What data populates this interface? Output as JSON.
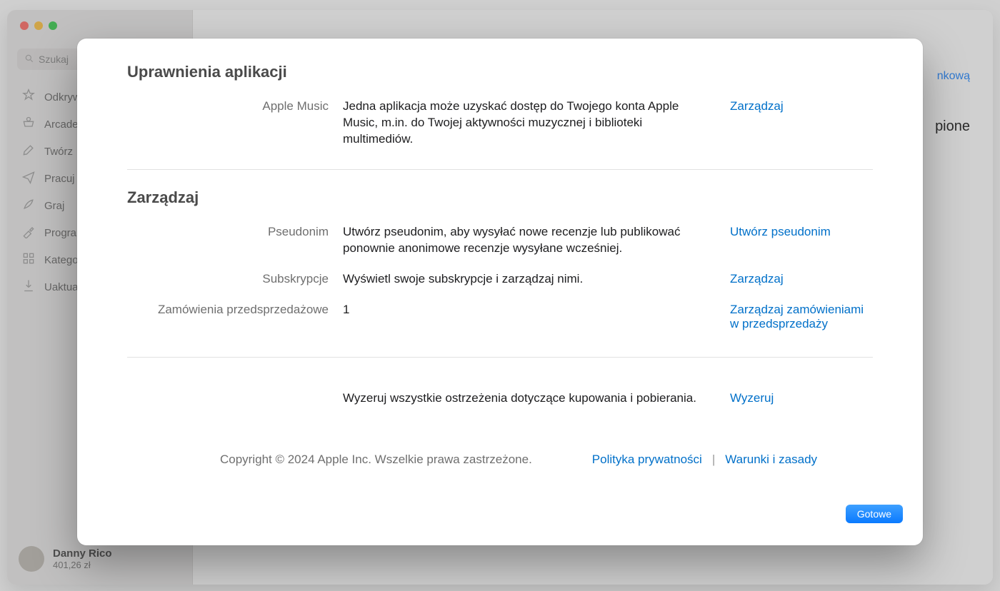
{
  "sidebar": {
    "search_placeholder": "Szukaj",
    "items": [
      {
        "label": "Odkrywaj"
      },
      {
        "label": "Arcade"
      },
      {
        "label": "Twórz"
      },
      {
        "label": "Pracuj"
      },
      {
        "label": "Graj"
      },
      {
        "label": "Programuj"
      },
      {
        "label": "Kategorie"
      },
      {
        "label": "Uaktualnienia"
      }
    ],
    "user": {
      "name": "Danny Rico",
      "balance": "401,26 zł"
    }
  },
  "background": {
    "header_link": "nkową",
    "right_heading": "pione"
  },
  "modal": {
    "sections": {
      "permissions": {
        "title": "Uprawnienia aplikacji",
        "apple_music": {
          "label": "Apple Music",
          "desc": "Jedna aplikacja może uzyskać dostęp do Twojego konta Apple Music, m.in. do Twojej aktywności muzycznej i biblioteki multimediów.",
          "action": "Zarządzaj"
        }
      },
      "manage": {
        "title": "Zarządzaj",
        "nickname": {
          "label": "Pseudonim",
          "desc": "Utwórz pseudonim, aby wysyłać nowe recenzje lub publikować ponownie anonimowe recenzje wysyłane wcześniej.",
          "action": "Utwórz pseudonim"
        },
        "subs": {
          "label": "Subskrypcje",
          "desc": "Wyświetl swoje subskrypcje i zarządzaj nimi.",
          "action": "Zarządzaj"
        },
        "preorders": {
          "label": "Zamówienia przedsprzedażowe",
          "desc": "1",
          "action": "Zarządzaj zamówieniami w przedsprzedaży"
        }
      },
      "reset": {
        "desc": "Wyzeruj wszystkie ostrzeżenia dotyczące kupowania i pobierania.",
        "action": "Wyzeruj"
      }
    },
    "footer": {
      "copyright": "Copyright © 2024 Apple Inc. Wszelkie prawa zastrzeżone.",
      "privacy": "Polityka prywatności",
      "terms": "Warunki i zasady"
    },
    "done_label": "Gotowe"
  }
}
